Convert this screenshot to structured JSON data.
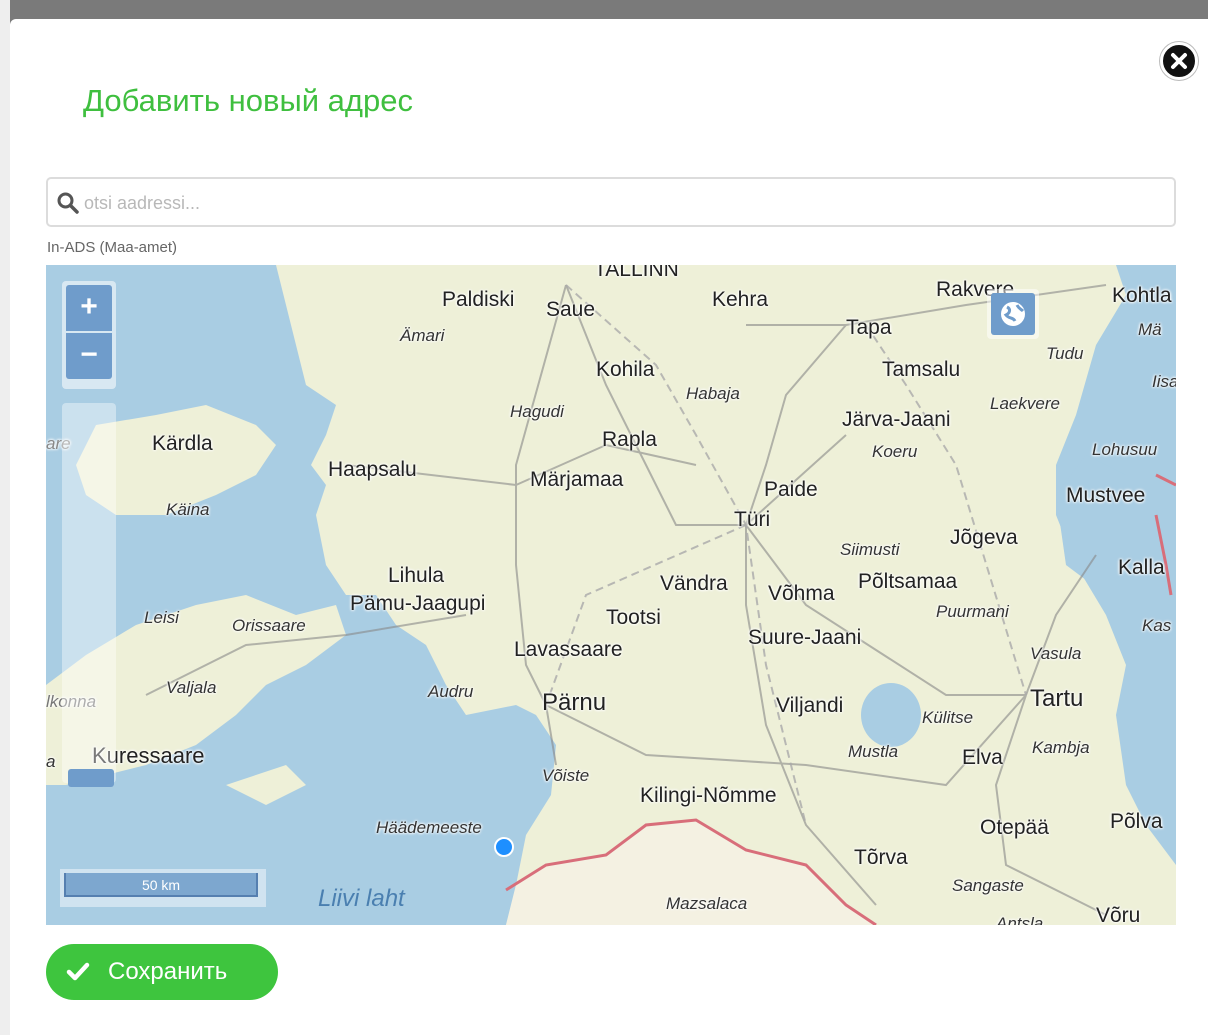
{
  "dialog": {
    "title": "Добавить новый адрес",
    "close_icon": "close-icon"
  },
  "search": {
    "placeholder": "otsi aadressi...",
    "value": "",
    "icon": "search-icon"
  },
  "source_label": "In-ADS (Maa-amet)",
  "map": {
    "zoom_in_label": "+",
    "zoom_out_label": "−",
    "scale_label": "50 km",
    "water_label": "Liivi laht",
    "places": [
      {
        "key": "tallinn",
        "name": "TALLINN"
      },
      {
        "key": "paldiski",
        "name": "Paldiski"
      },
      {
        "key": "saue",
        "name": "Saue"
      },
      {
        "key": "kehra",
        "name": "Kehra"
      },
      {
        "key": "rakvere",
        "name": "Rakvere"
      },
      {
        "key": "kohtla",
        "name": "Kohtla"
      },
      {
        "key": "amari",
        "name": "Ämari"
      },
      {
        "key": "tapa",
        "name": "Tapa"
      },
      {
        "key": "ma",
        "name": "Mä"
      },
      {
        "key": "kohila",
        "name": "Kohila"
      },
      {
        "key": "tudu",
        "name": "Tudu"
      },
      {
        "key": "tamsalu",
        "name": "Tamsalu"
      },
      {
        "key": "habaja",
        "name": "Habaja"
      },
      {
        "key": "iisaku",
        "name": "Iisa"
      },
      {
        "key": "hagudi",
        "name": "Hagudi"
      },
      {
        "key": "laekvere",
        "name": "Laekvere"
      },
      {
        "key": "jarva_jaani",
        "name": "Järva-Jaani"
      },
      {
        "key": "rapla",
        "name": "Rapla"
      },
      {
        "key": "kardla",
        "name": "Kärdla"
      },
      {
        "key": "are",
        "name": "are"
      },
      {
        "key": "koeru",
        "name": "Koeru"
      },
      {
        "key": "lohusuu",
        "name": "Lohusuu"
      },
      {
        "key": "haapsalu",
        "name": "Haapsalu"
      },
      {
        "key": "marjamaa",
        "name": "Märjamaa"
      },
      {
        "key": "paide",
        "name": "Paide"
      },
      {
        "key": "mustvee",
        "name": "Mustvee"
      },
      {
        "key": "kaina",
        "name": "Käina"
      },
      {
        "key": "turi",
        "name": "Türi"
      },
      {
        "key": "siimusti",
        "name": "Siimusti"
      },
      {
        "key": "jogeva",
        "name": "Jõgeva"
      },
      {
        "key": "kallaste",
        "name": "Kalla"
      },
      {
        "key": "lihula",
        "name": "Lihula"
      },
      {
        "key": "vandra",
        "name": "Vändra"
      },
      {
        "key": "voh ma",
        "name": "Võhma"
      },
      {
        "key": "poltsamaa",
        "name": "Põltsamaa"
      },
      {
        "key": "pamu",
        "name": "Pämu-Jaagupi"
      },
      {
        "key": "leisi",
        "name": "Leisi"
      },
      {
        "key": "orissaare",
        "name": "Orissaare"
      },
      {
        "key": "tootsi",
        "name": "Tootsi"
      },
      {
        "key": "puurmani",
        "name": "Puurmani"
      },
      {
        "key": "kas",
        "name": "Kas"
      },
      {
        "key": "suure_jaani",
        "name": "Suure-Jaani"
      },
      {
        "key": "lavassaare",
        "name": "Lavassaare"
      },
      {
        "key": "vasula",
        "name": "Vasula"
      },
      {
        "key": "valjala",
        "name": "Valjala"
      },
      {
        "key": "audru",
        "name": "Audru"
      },
      {
        "key": "parnu",
        "name": "Pärnu"
      },
      {
        "key": "tartu",
        "name": "Tartu"
      },
      {
        "key": "kihelkonna",
        "name": "lkonna"
      },
      {
        "key": "viljandi",
        "name": "Viljandi"
      },
      {
        "key": "kulitse",
        "name": "Külitse"
      },
      {
        "key": "kuressaare",
        "name": "Kuressaare"
      },
      {
        "key": "a",
        "name": "a"
      },
      {
        "key": "mustla",
        "name": "Mustla"
      },
      {
        "key": "elva",
        "name": "Elva"
      },
      {
        "key": "kambja",
        "name": "Kambja"
      },
      {
        "key": "voiste",
        "name": "Võiste"
      },
      {
        "key": "kilingi",
        "name": "Kilingi-Nõmme"
      },
      {
        "key": "haademeeste",
        "name": "Häädemeeste"
      },
      {
        "key": "otepaa",
        "name": "Otepää"
      },
      {
        "key": "polva",
        "name": "Põlva"
      },
      {
        "key": "torva",
        "name": "Tõrva"
      },
      {
        "key": "sangaste",
        "name": "Sangaste"
      },
      {
        "key": "mazsalaca",
        "name": "Mazsalaca"
      },
      {
        "key": "antsla",
        "name": "Antsla"
      },
      {
        "key": "voru",
        "name": "Võru"
      }
    ]
  },
  "save_button": {
    "label": "Сохранить",
    "icon": "check-icon",
    "color": "#3ec53e"
  },
  "colors": {
    "title": "#3fbf3f",
    "water": "#a9cde3",
    "land": "#eef0d8",
    "control": "#6f9ccb"
  }
}
